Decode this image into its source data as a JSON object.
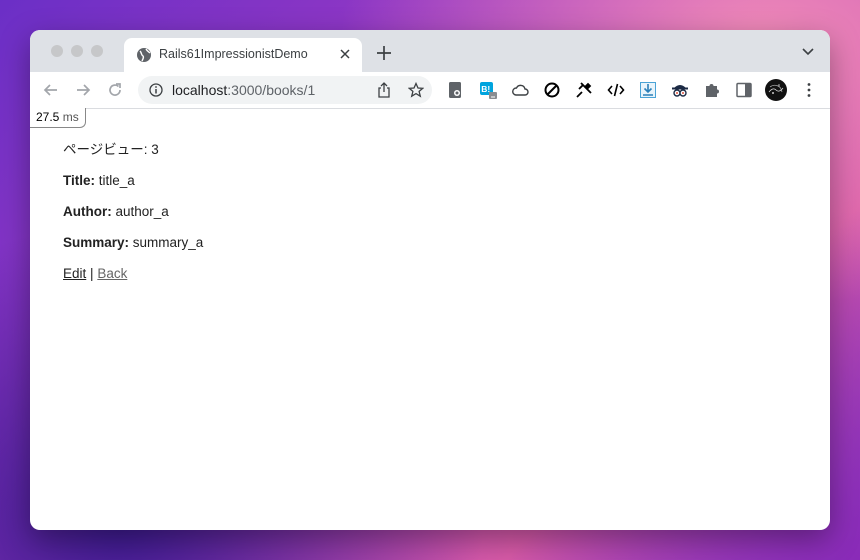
{
  "browser": {
    "tab_title": "Rails61ImpressionistDemo",
    "url_host": "localhost",
    "url_path": ":3000/books/1"
  },
  "profiler": {
    "value": "27.5",
    "unit": "ms"
  },
  "page": {
    "page_views": "ページビュー: 3",
    "title_label": "Title:",
    "title_value": "title_a",
    "author_label": "Author:",
    "author_value": "author_a",
    "summary_label": "Summary:",
    "summary_value": "summary_a",
    "edit_link": "Edit",
    "separator": "|",
    "back_link": "Back"
  },
  "icons": {
    "tab": [
      "globe-icon",
      "close-icon"
    ],
    "toolbar": [
      "back-icon",
      "forward-icon",
      "reload-icon",
      "info-icon",
      "share-icon",
      "bookmark-star-icon"
    ],
    "extensions": [
      "page-extension-icon",
      "hatena-bookmark-icon",
      "cloud-icon",
      "block-icon",
      "pin-icon",
      "code-icon",
      "download-icon",
      "spy-icon",
      "puzzle-icon",
      "sidepanel-icon",
      "profile-avatar",
      "more-menu-icon"
    ]
  }
}
